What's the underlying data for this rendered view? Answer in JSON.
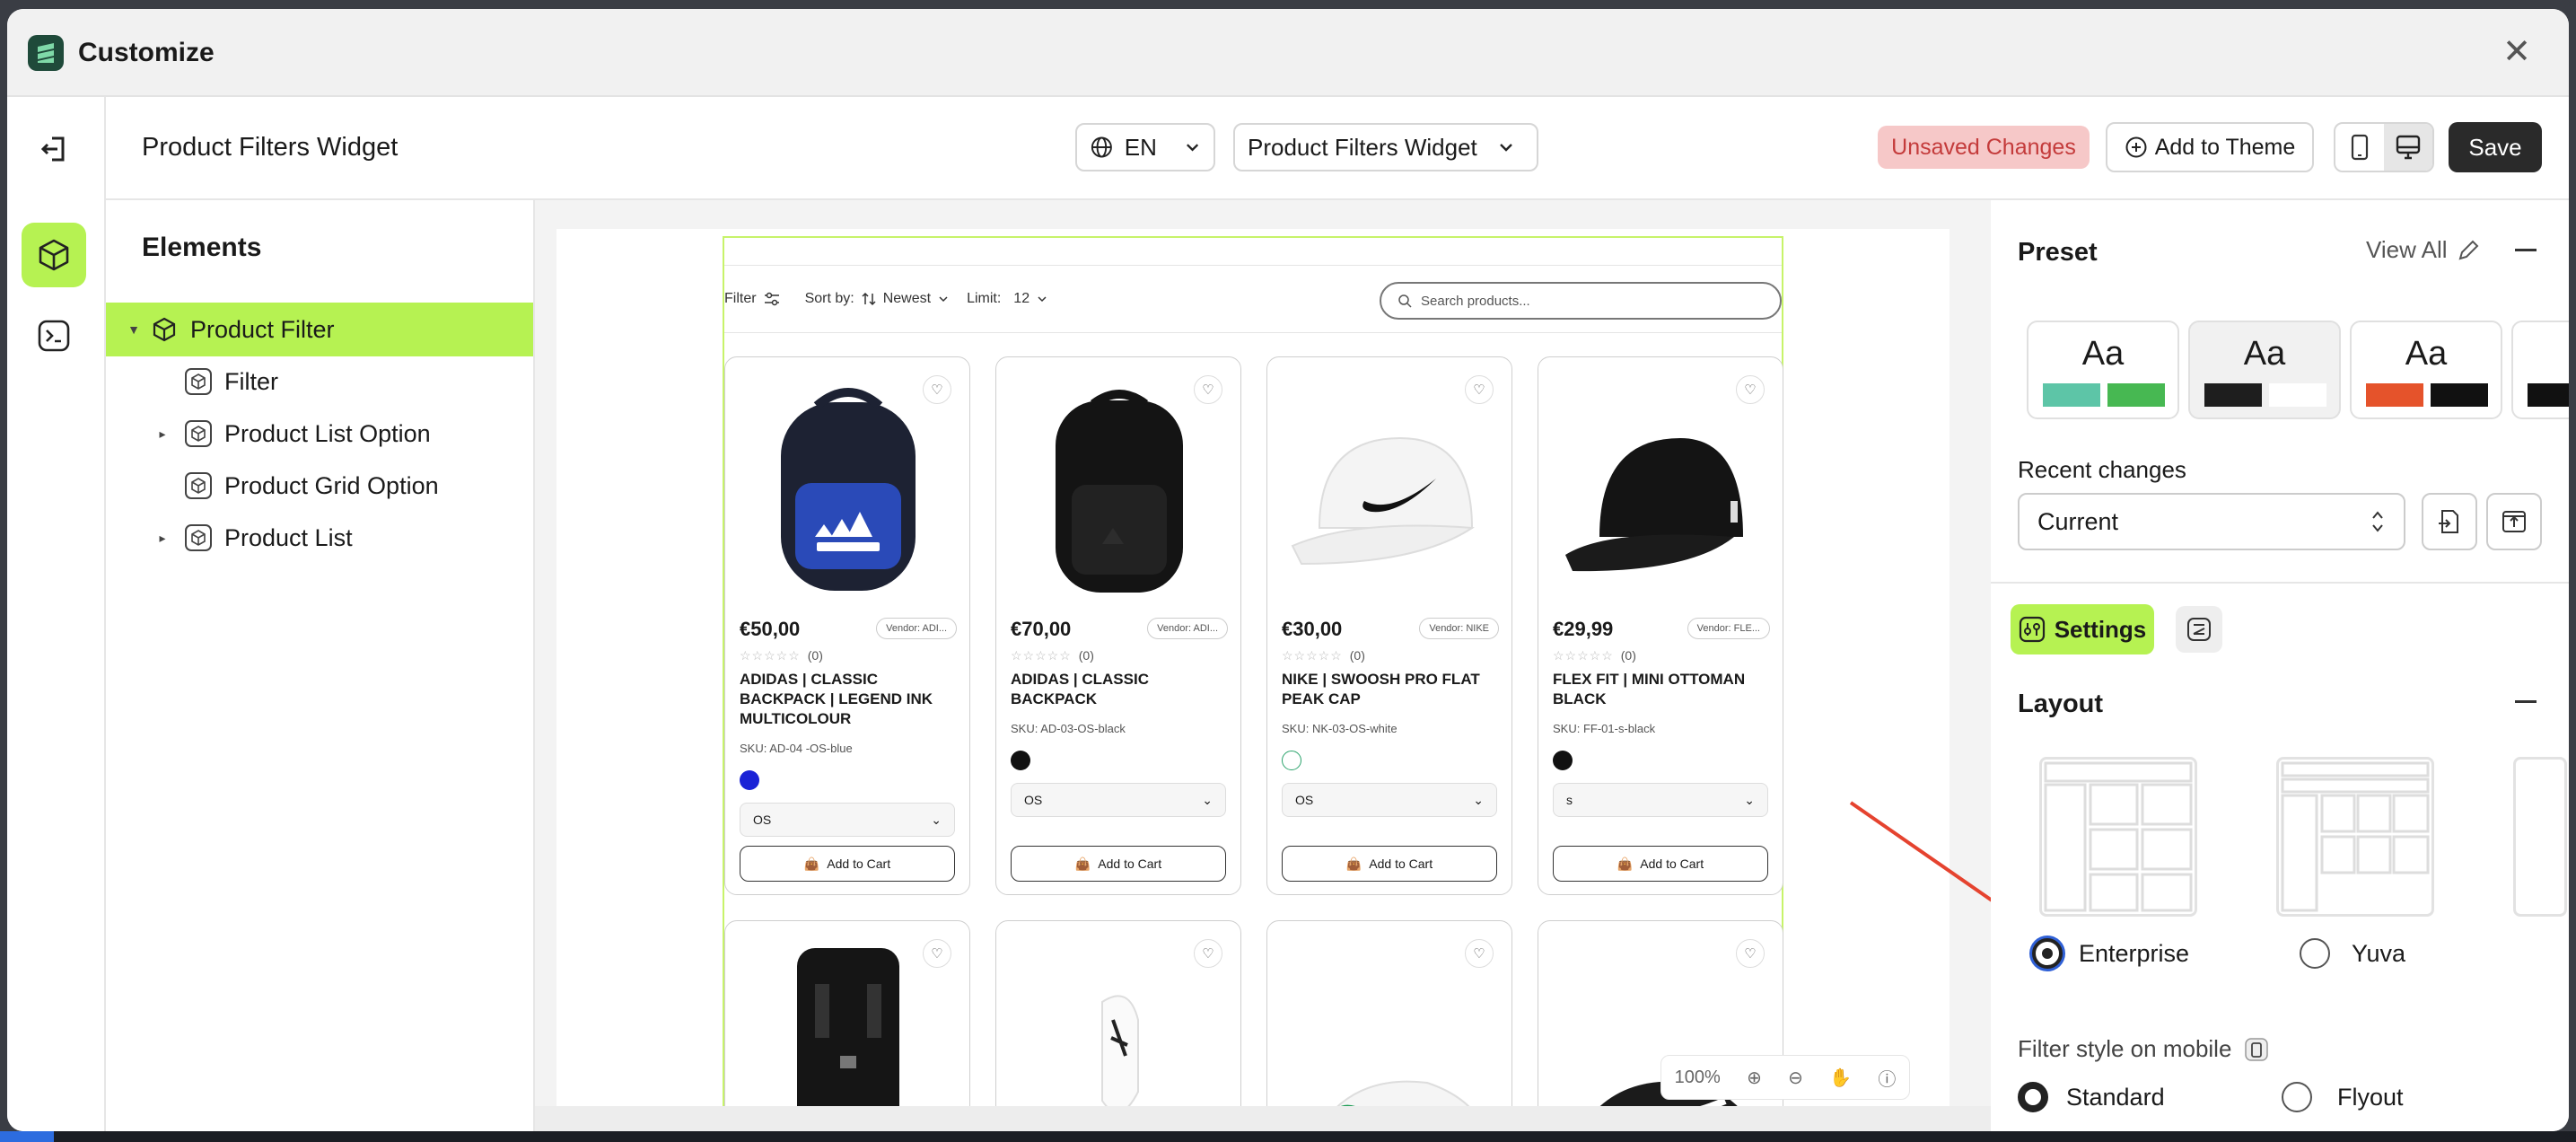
{
  "window": {
    "title": "Customize"
  },
  "topbar": {
    "heading": "Product Filters Widget",
    "language": "EN",
    "widget_select": "Product Filters Widget",
    "unsaved": "Unsaved Changes",
    "add_to_theme": "Add to Theme",
    "save": "Save"
  },
  "elements": {
    "heading": "Elements",
    "tree": [
      {
        "label": "Product Filter",
        "selected": true,
        "expandable": true
      },
      {
        "label": "Filter",
        "expandable": false
      },
      {
        "label": "Product List Option",
        "expandable": true
      },
      {
        "label": "Product Grid Option",
        "expandable": false
      },
      {
        "label": "Product List",
        "expandable": true
      }
    ]
  },
  "store": {
    "filter_label": "Filter",
    "sort_label": "Sort by:",
    "sort_value": "Newest",
    "limit_label": "Limit:",
    "limit_value": "12",
    "search_placeholder": "Search products...",
    "add_to_cart": "Add to Cart",
    "products": [
      {
        "price": "€50,00",
        "vendor": "Vendor: ADI...",
        "reviews": "(0)",
        "name": "ADIDAS | CLASSIC BACKPACK | LEGEND INK MULTICOLOUR",
        "sku": "SKU: AD-04 -OS-blue",
        "swatch": "#1a22d6",
        "option": "OS"
      },
      {
        "price": "€70,00",
        "vendor": "Vendor: ADI...",
        "reviews": "(0)",
        "name": "ADIDAS | CLASSIC BACKPACK",
        "sku": "SKU: AD-03-OS-black",
        "swatch": "#111111",
        "option": "OS"
      },
      {
        "price": "€30,00",
        "vendor": "Vendor: NIKE",
        "reviews": "(0)",
        "name": "NIKE | SWOOSH PRO FLAT PEAK CAP",
        "sku": "SKU: NK-03-OS-white",
        "swatch": "#ffffff",
        "option": "OS"
      },
      {
        "price": "€29,99",
        "vendor": "Vendor: FLE...",
        "reviews": "(0)",
        "name": "FLEX FIT | MINI OTTOMAN BLACK",
        "sku": "SKU: FF-01-s-black",
        "swatch": "#111111",
        "option": "s"
      }
    ]
  },
  "zoom": {
    "level": "100%"
  },
  "panel": {
    "preset_heading": "Preset",
    "view_all": "View All",
    "preset_label": "Aa",
    "recent_changes_label": "Recent changes",
    "recent_changes_value": "Current",
    "settings_tab": "Settings",
    "layout_heading": "Layout",
    "layout_options": [
      "Enterprise",
      "Yuva"
    ],
    "filter_mobile_label": "Filter style on mobile",
    "filter_mobile_options": [
      "Standard",
      "Flyout"
    ]
  },
  "colors": {
    "accent": "#b6f252",
    "dark": "#2a2a2a",
    "unsaved_bg": "#f6c8c8",
    "unsaved_text": "#c43b3b",
    "arrow": "#e5432f"
  }
}
